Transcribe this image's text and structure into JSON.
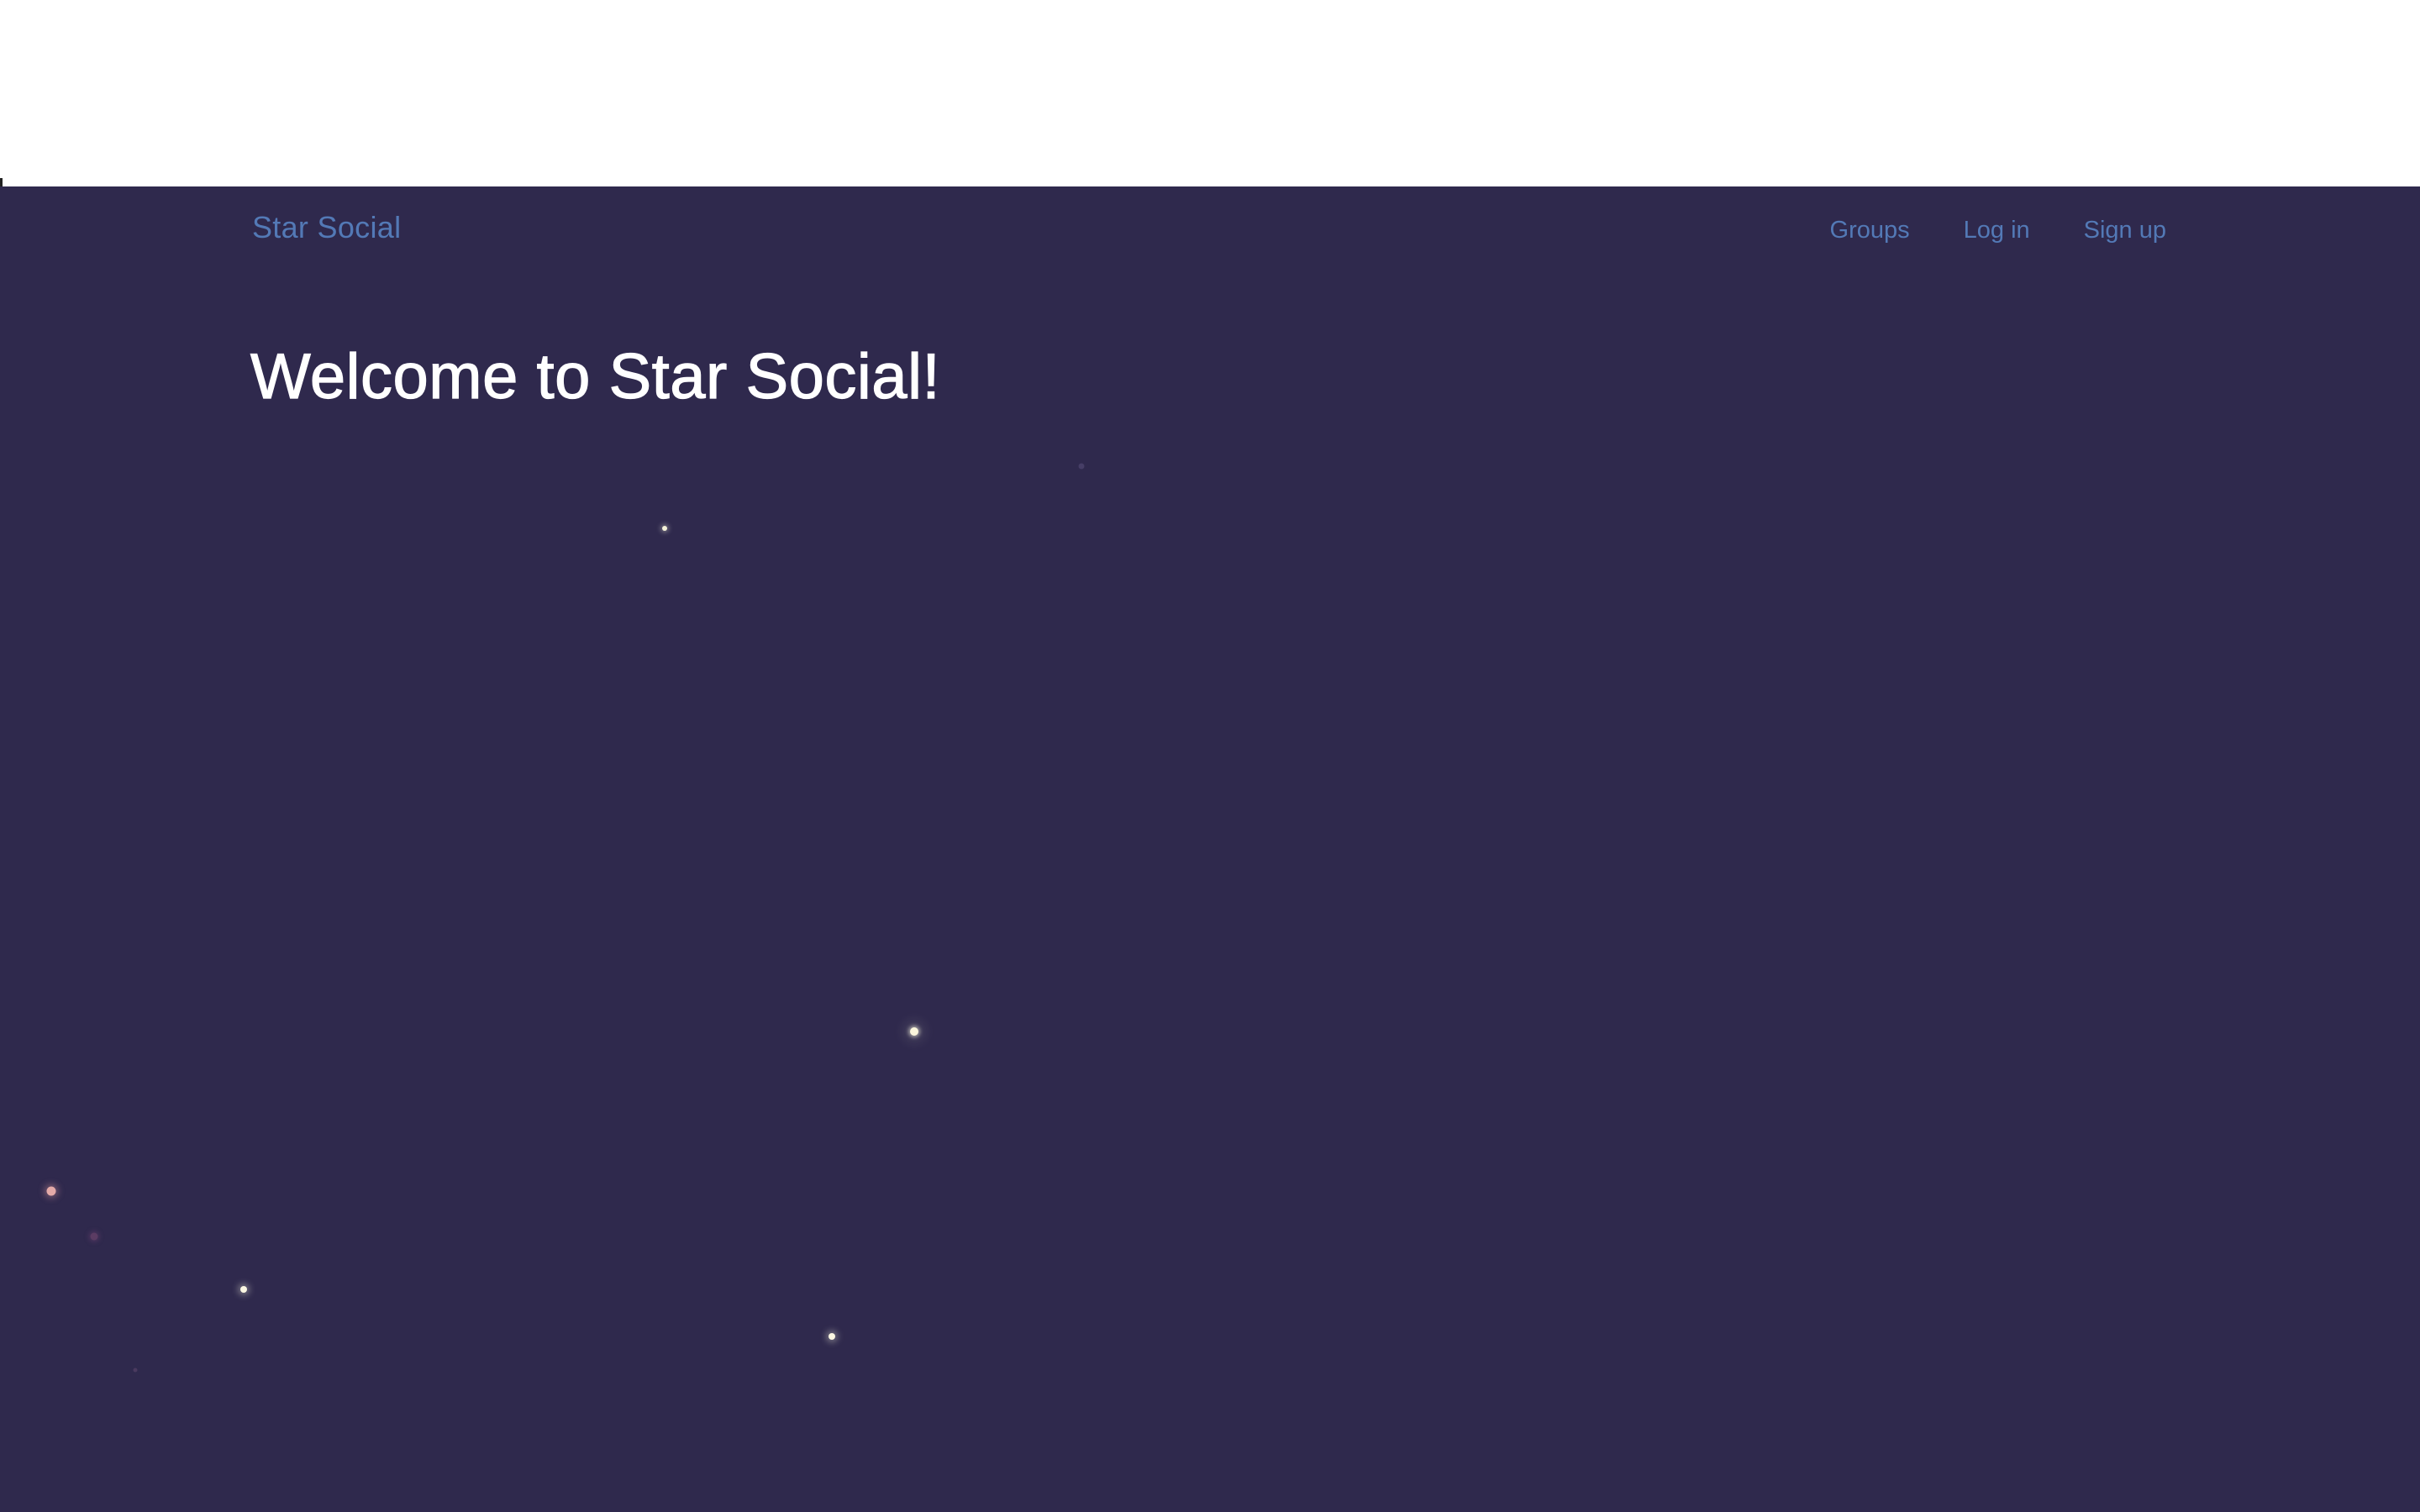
{
  "navbar": {
    "brand": "Star Social",
    "links": [
      {
        "label": "Groups"
      },
      {
        "label": "Log in"
      },
      {
        "label": "Sign up"
      }
    ]
  },
  "hero": {
    "title": "Welcome to Star Social!"
  },
  "colors": {
    "background": "#2f294d",
    "link": "#5379b6",
    "title": "#ffffff",
    "top_band": "#ffffff"
  },
  "icons": {
    "stars": "star-dot"
  }
}
